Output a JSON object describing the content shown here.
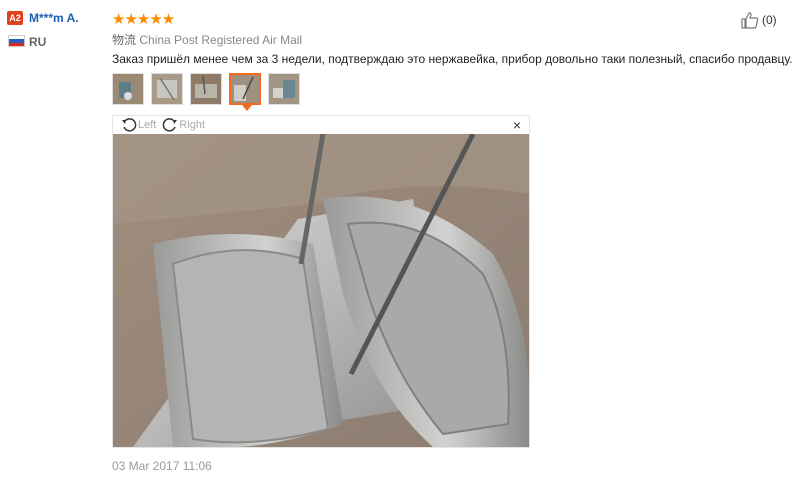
{
  "reviewer": {
    "badge": "A2",
    "name": "M***m A.",
    "country": "RU"
  },
  "rating": {
    "stars": 5,
    "display": "★★★★★"
  },
  "likes": {
    "count": "(0)"
  },
  "shipping": {
    "label": "物流",
    "method": "China Post Registered Air Mail"
  },
  "comment": "Заказ пришёл менее чем за 3 недели, подтверждаю это нержавейка, прибор довольно таки полезный, спасибо продавцу.",
  "thumbnails": {
    "count": 5,
    "selected_index": 3
  },
  "viewer": {
    "rotate_left_label": "Left",
    "rotate_right_label": "Right",
    "close_glyph": "×"
  },
  "date": "03 Mar 2017 11:06",
  "colors": {
    "accent_orange": "#f26b21",
    "star": "#ff8a00",
    "link_blue": "#1a5fb4",
    "badge_red": "#e0411e"
  }
}
